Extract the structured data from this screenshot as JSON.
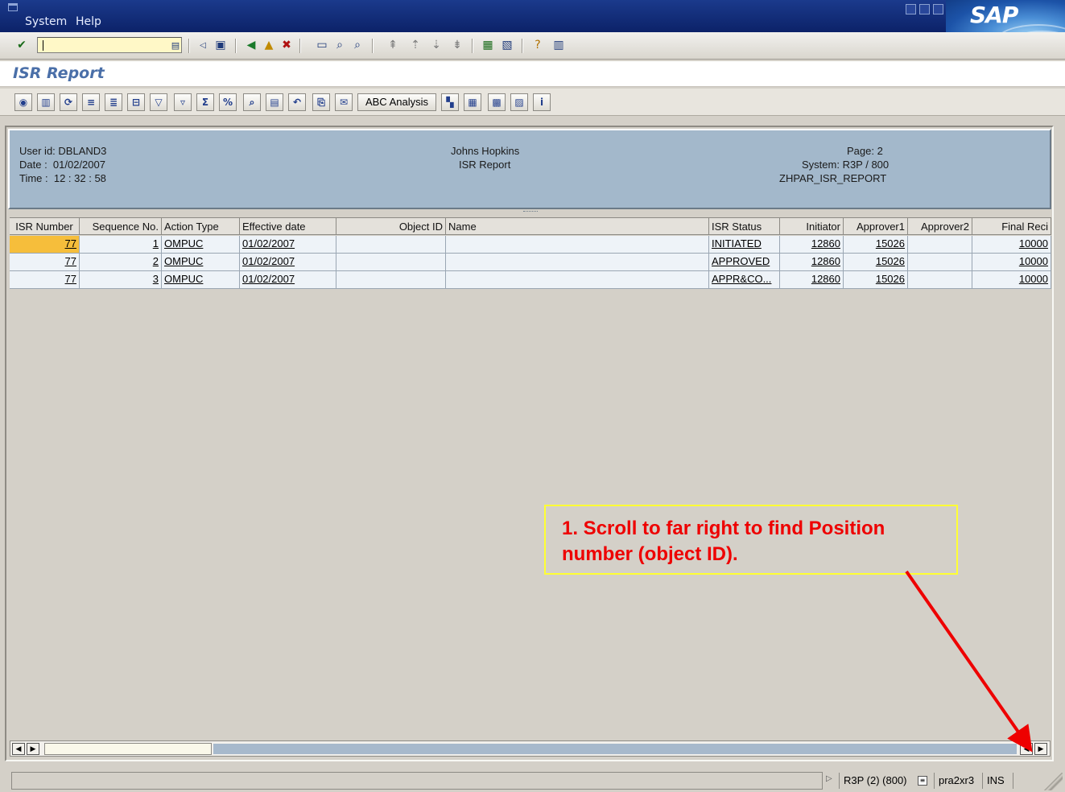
{
  "menubar": {
    "items": [
      "System",
      "Help"
    ]
  },
  "window_title": "ISR Report",
  "app_toolbar": {
    "abc_label": "ABC Analysis"
  },
  "report_header": {
    "user_id": "User id: DBLAND3",
    "date": "Date :  01/02/2007",
    "time": "Time :  12 : 32 : 58",
    "org": "Johns Hopkins",
    "report_name": "ISR Report",
    "page": "Page: 2",
    "system": "System: R3P / 800",
    "program": "ZHPAR_ISR_REPORT"
  },
  "grid": {
    "columns": [
      "ISR Number",
      "Sequence No.",
      "Action Type",
      "Effective date",
      "Object ID",
      "Name",
      "ISR Status",
      "Initiator",
      "Approver1",
      "Approver2",
      "Final Reci"
    ],
    "rows": [
      [
        "77",
        "1",
        "OMPUC",
        "01/02/2007",
        "",
        "",
        "INITIATED",
        "12860",
        "15026",
        "",
        "10000"
      ],
      [
        "77",
        "2",
        "OMPUC",
        "01/02/2007",
        "",
        "",
        "APPROVED",
        "12860",
        "15026",
        "",
        "10000"
      ],
      [
        "77",
        "3",
        "OMPUC",
        "01/02/2007",
        "",
        "",
        "APPR&CO...",
        "12860",
        "15026",
        "",
        "10000"
      ]
    ]
  },
  "statusbar": {
    "system": "R3P (2) (800)",
    "server": "pra2xr3",
    "mode": "INS"
  },
  "callout": {
    "text": "1.  Scroll to far right to find Position number (object ID)."
  },
  "colors": {
    "title_blue": "#4a6fa8",
    "header_panel": "#a3b8cb",
    "selected_cell": "#f6be3b",
    "callout_text": "#ee0000",
    "callout_border": "#ffff33"
  }
}
